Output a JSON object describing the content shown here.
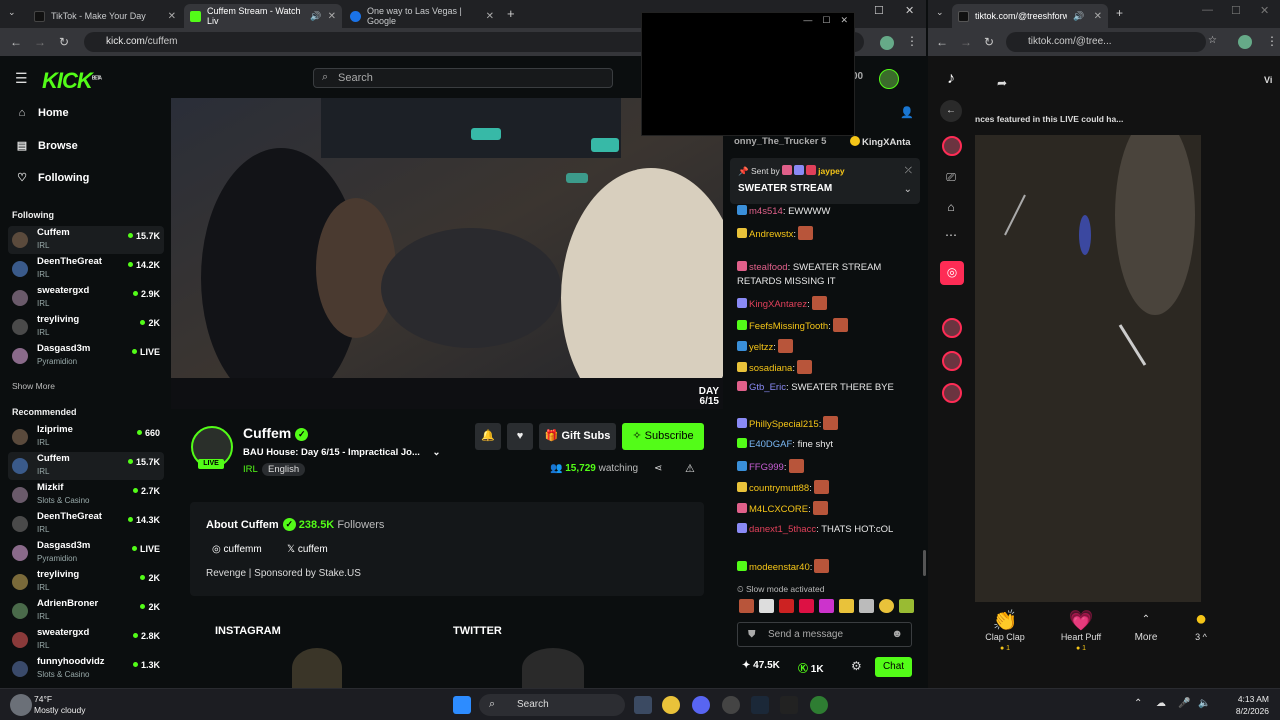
{
  "browser_left": {
    "tabs": [
      {
        "title": "TikTok - Make Your Day",
        "active": false
      },
      {
        "title": "Cuffem Stream - Watch Liv",
        "active": true
      },
      {
        "title": "One way to Las Vegas | Google",
        "active": false
      }
    ],
    "url_host": "kick.com",
    "url_path": "/cuffem"
  },
  "kick": {
    "logo": "KICK",
    "logo_tag": "BETA",
    "search_placeholder": "Search",
    "points": "00",
    "nav": [
      {
        "label": "Home",
        "icon": "home-icon"
      },
      {
        "label": "Browse",
        "icon": "browse-icon"
      },
      {
        "label": "Following",
        "icon": "heart-icon"
      }
    ],
    "following_title": "Following",
    "following": [
      {
        "name": "Cuffem",
        "category": "IRL",
        "viewers": "15.7K",
        "selected": true
      },
      {
        "name": "DeenTheGreat",
        "category": "IRL",
        "viewers": "14.2K"
      },
      {
        "name": "sweatergxd",
        "category": "IRL",
        "viewers": "2.9K"
      },
      {
        "name": "treyliving",
        "category": "IRL",
        "viewers": "2K"
      },
      {
        "name": "Dasgasd3m",
        "category": "Pyramidion",
        "viewers": "LIVE"
      }
    ],
    "show_more": "Show More",
    "recommended_title": "Recommended",
    "recommended": [
      {
        "name": "Iziprime",
        "category": "IRL",
        "viewers": "660"
      },
      {
        "name": "Cuffem",
        "category": "IRL",
        "viewers": "15.7K",
        "selected": true
      },
      {
        "name": "Mizkif",
        "category": "Slots & Casino",
        "viewers": "2.7K"
      },
      {
        "name": "DeenTheGreat",
        "category": "IRL",
        "viewers": "14.3K"
      },
      {
        "name": "Dasgasd3m",
        "category": "Pyramidion",
        "viewers": "LIVE"
      },
      {
        "name": "treyliving",
        "category": "IRL",
        "viewers": "2K"
      },
      {
        "name": "AdrienBroner",
        "category": "IRL",
        "viewers": "2K"
      },
      {
        "name": "sweatergxd",
        "category": "IRL",
        "viewers": "2.8K"
      },
      {
        "name": "funnyhoodvidz",
        "category": "Slots & Casino",
        "viewers": "1.3K"
      }
    ],
    "video_day_tag_1": "DAY",
    "video_day_tag_2": "6/15",
    "streamer": {
      "name": "Cuffem",
      "live_badge": "LIVE",
      "title": "BAU House: Day 6/15 - Impractical Jo...",
      "category": "IRL",
      "language": "English",
      "watching_count": "15,729",
      "watching_label": "watching"
    },
    "buttons": {
      "gift_subs": "Gift Subs",
      "subscribe": "Subscribe"
    },
    "about": {
      "heading": "About Cuffem",
      "followers_count": "238.5K",
      "followers_label": "Followers",
      "instagram": "cuffemm",
      "twitter": "cuffem",
      "description": "Revenge | Sponsored by Stake.US"
    },
    "panel_labels": {
      "instagram": "INSTAGRAM",
      "twitter": "TWITTER"
    }
  },
  "chat": {
    "top_user_1": "onny_The_Trucker",
    "top_user_1_count": "5",
    "top_user_2": "KingXAnta",
    "pinned_sent_by": "Sent by",
    "pinned_user": "jaypey",
    "pinned_message": "SWEATER STREAM",
    "messages": [
      {
        "user": "m4s514",
        "color": "#e0608a",
        "text": ": EWWWW"
      },
      {
        "user": "Andrewstx",
        "color": "#f5c518",
        "text": ":"
      },
      {
        "user": "stealfood",
        "color": "#e0608a",
        "text": ": SWEATER STREAM RETARDS MISSING IT"
      },
      {
        "user": "KingXAntarez",
        "color": "#e0405a",
        "text": ":"
      },
      {
        "user": "FeefsMissingTooth",
        "color": "#f5c518",
        "text": ":"
      },
      {
        "user": "yeltzz",
        "color": "#f5c518",
        "text": ":"
      },
      {
        "user": "sosadiana",
        "color": "#f5c518",
        "text": ":"
      },
      {
        "user": "Gtb_Eric",
        "color": "#8a8af5",
        "text": ": SWEATER THERE BYE"
      },
      {
        "user": "PhillySpecial215",
        "color": "#f5c518",
        "text": ":"
      },
      {
        "user": "E40DGAF",
        "color": "#7ab8f5",
        "text": ": fine shyt"
      },
      {
        "user": "FFG999",
        "color": "#c85fd5",
        "text": ":"
      },
      {
        "user": "countrymutt88",
        "color": "#f5c518",
        "text": ":"
      },
      {
        "user": "M4LCXCORE",
        "color": "#f5c518",
        "text": ":"
      },
      {
        "user": "danext1_5thacc",
        "color": "#e0405a",
        "text": ": THATS HOT:cOL"
      },
      {
        "user": "modeenstar40",
        "color": "#f5c518",
        "text": ":"
      }
    ],
    "slow_mode": "Slow mode activated",
    "input_placeholder": "Send a message",
    "stat_points": "47.5K",
    "stat_kicks": "1K",
    "chat_button": "Chat"
  },
  "browser_right": {
    "url": "tiktok.com/@tree...",
    "tab_title": "tiktok.com/@treeshforwhat",
    "live_notice": "nces featured in this LIVE could ha...",
    "side_label": "Vi",
    "gifts": [
      {
        "name": "Clap Clap",
        "coins": "1"
      },
      {
        "name": "Heart Puff",
        "coins": "1"
      }
    ],
    "more_label": "More",
    "coins_label": "3"
  },
  "taskbar": {
    "weather_temp": "74°F",
    "weather_desc": "Mostly cloudy",
    "search_label": "Search",
    "time": "4:13 AM",
    "date": "8/2/2026"
  },
  "colors": {
    "kick_green": "#53fc18",
    "tiktok_red": "#fe2c55"
  }
}
